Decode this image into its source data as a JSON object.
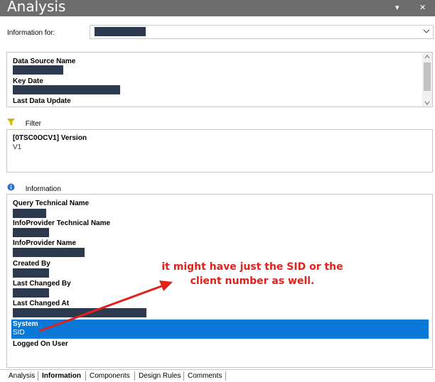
{
  "window": {
    "title": "Analysis",
    "dropdown_glyph": "▾",
    "close_glyph": "✕"
  },
  "info_for": {
    "label": "Information for:"
  },
  "datasource": {
    "fields": [
      {
        "label": "Data Source Name"
      },
      {
        "label": "Key Date"
      },
      {
        "label": "Last Data Update"
      }
    ]
  },
  "filter": {
    "title": "Filter",
    "entries": [
      {
        "label": "[0TSC0OCV1] Version",
        "value": "V1"
      }
    ]
  },
  "information": {
    "title": "Information",
    "fields": [
      {
        "label": "Query Technical Name"
      },
      {
        "label": "InfoProvider Technical Name"
      },
      {
        "label": "InfoProvider Name"
      },
      {
        "label": "Created By"
      },
      {
        "label": "Last Changed By"
      },
      {
        "label": "Last Changed At"
      },
      {
        "label": "System",
        "value": "SID"
      },
      {
        "label": "Logged On User"
      }
    ]
  },
  "tabs": [
    "Analysis",
    "Information",
    "Components",
    "Design Rules",
    "Comments"
  ],
  "active_tab": "Information",
  "annotation": {
    "line1": "it might have just the SID or the",
    "line2": "client number as well.",
    "color": "#e3201b"
  },
  "colors": {
    "selection": "#0a78d7",
    "titlebar": "#6d6d6d",
    "redaction": "#2d3a4e"
  },
  "icons": {
    "filter": "filter-funnel-icon",
    "information": "info-icon"
  }
}
